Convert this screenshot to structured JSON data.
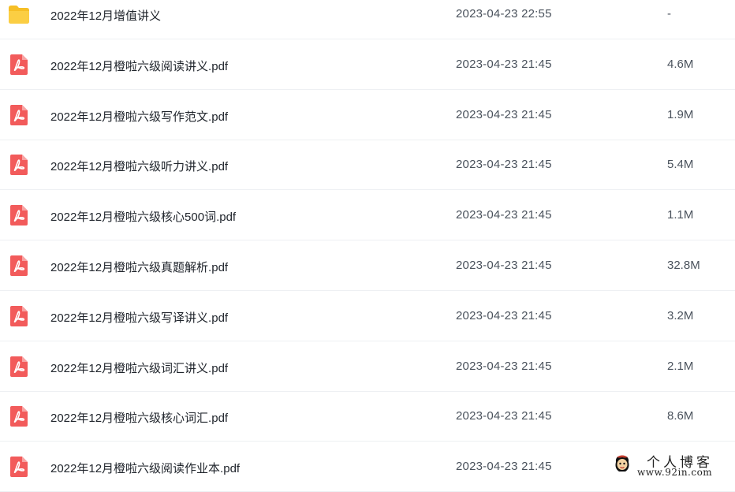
{
  "colors": {
    "folder": "#f6bf26",
    "pdf": "#f25b5b",
    "text_primary": "#20252c",
    "text_secondary": "#4a525c",
    "divider": "#eef0f3"
  },
  "files": [
    {
      "icon": "folder-icon",
      "name": "2022年12月增值讲义",
      "date": "2023-04-23 22:55",
      "size": "-"
    },
    {
      "icon": "pdf-icon",
      "name": "2022年12月橙啦六级阅读讲义.pdf",
      "date": "2023-04-23 21:45",
      "size": "4.6M"
    },
    {
      "icon": "pdf-icon",
      "name": "2022年12月橙啦六级写作范文.pdf",
      "date": "2023-04-23 21:45",
      "size": "1.9M"
    },
    {
      "icon": "pdf-icon",
      "name": "2022年12月橙啦六级听力讲义.pdf",
      "date": "2023-04-23 21:45",
      "size": "5.4M"
    },
    {
      "icon": "pdf-icon",
      "name": "2022年12月橙啦六级核心500词.pdf",
      "date": "2023-04-23 21:45",
      "size": "1.1M"
    },
    {
      "icon": "pdf-icon",
      "name": "2022年12月橙啦六级真题解析.pdf",
      "date": "2023-04-23 21:45",
      "size": "32.8M"
    },
    {
      "icon": "pdf-icon",
      "name": "2022年12月橙啦六级写译讲义.pdf",
      "date": "2023-04-23 21:45",
      "size": "3.2M"
    },
    {
      "icon": "pdf-icon",
      "name": "2022年12月橙啦六级词汇讲义.pdf",
      "date": "2023-04-23 21:45",
      "size": "2.1M"
    },
    {
      "icon": "pdf-icon",
      "name": "2022年12月橙啦六级核心词汇.pdf",
      "date": "2023-04-23 21:45",
      "size": "8.6M"
    },
    {
      "icon": "pdf-icon",
      "name": "2022年12月橙啦六级阅读作业本.pdf",
      "date": "2023-04-23 21:45",
      "size": ""
    }
  ],
  "watermark": {
    "title": "个人博客",
    "url": "www.92in.com"
  }
}
